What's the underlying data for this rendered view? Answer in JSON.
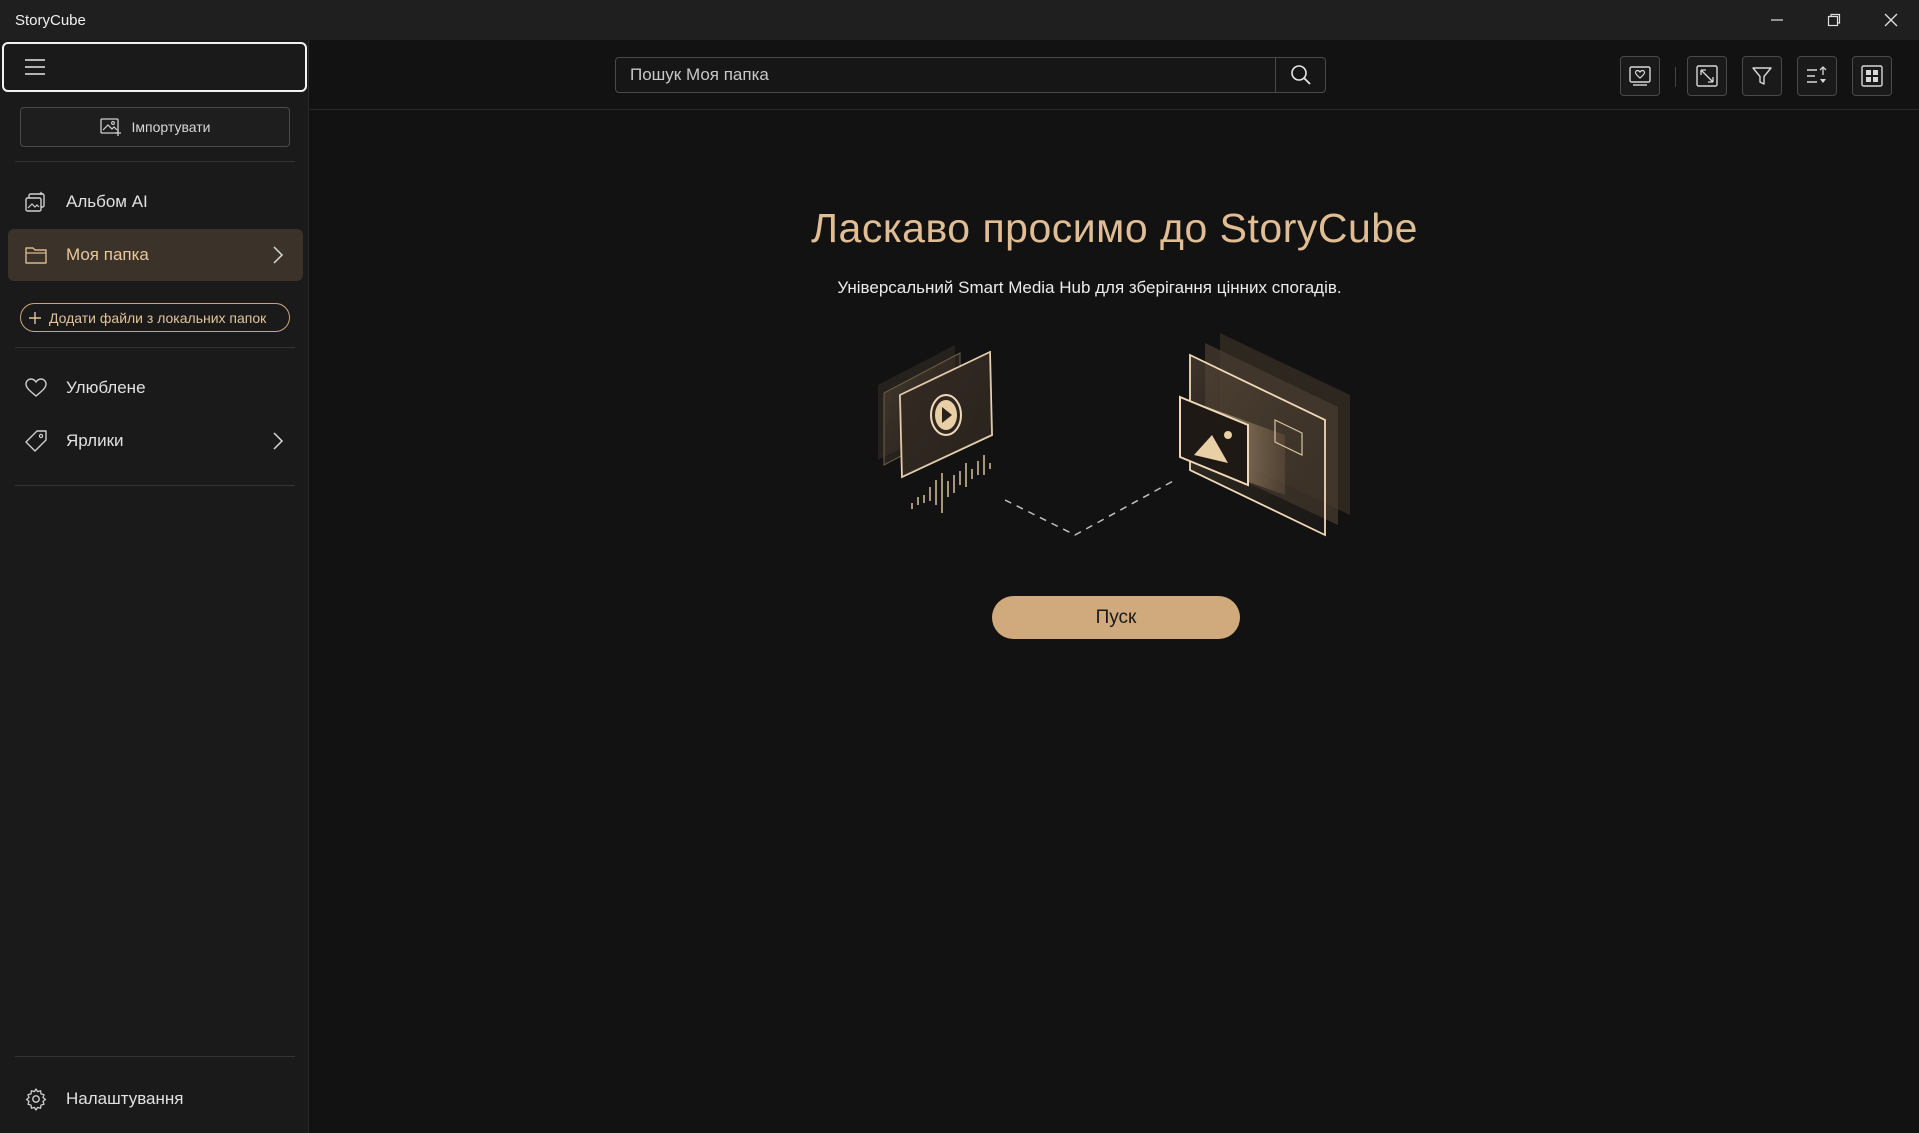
{
  "window": {
    "title": "StoryCube"
  },
  "sidebar": {
    "import_label": "Імпортувати",
    "items": [
      {
        "label": "Альбом AI",
        "icon": "album-ai-icon"
      },
      {
        "label": "Моя папка",
        "icon": "folder-icon",
        "active": true
      },
      {
        "label": "Улюблене",
        "icon": "heart-icon"
      },
      {
        "label": "Ярлики",
        "icon": "tag-icon"
      }
    ],
    "add_local_label": "Додати файли з локальних папок",
    "settings_label": "Налаштування"
  },
  "search": {
    "placeholder": "Пошук Моя папка"
  },
  "main": {
    "title": "Ласкаво просимо до StoryCube",
    "subtitle": "Універсальний Smart Media Hub для зберігання цінних спогадів.",
    "start_label": "Пуск"
  },
  "colors": {
    "accent": "#d0a97c",
    "accent_text": "#e0bd93",
    "active_bg": "#3b3229",
    "background": "#121212",
    "sidebar_bg": "#1a1a1a"
  }
}
